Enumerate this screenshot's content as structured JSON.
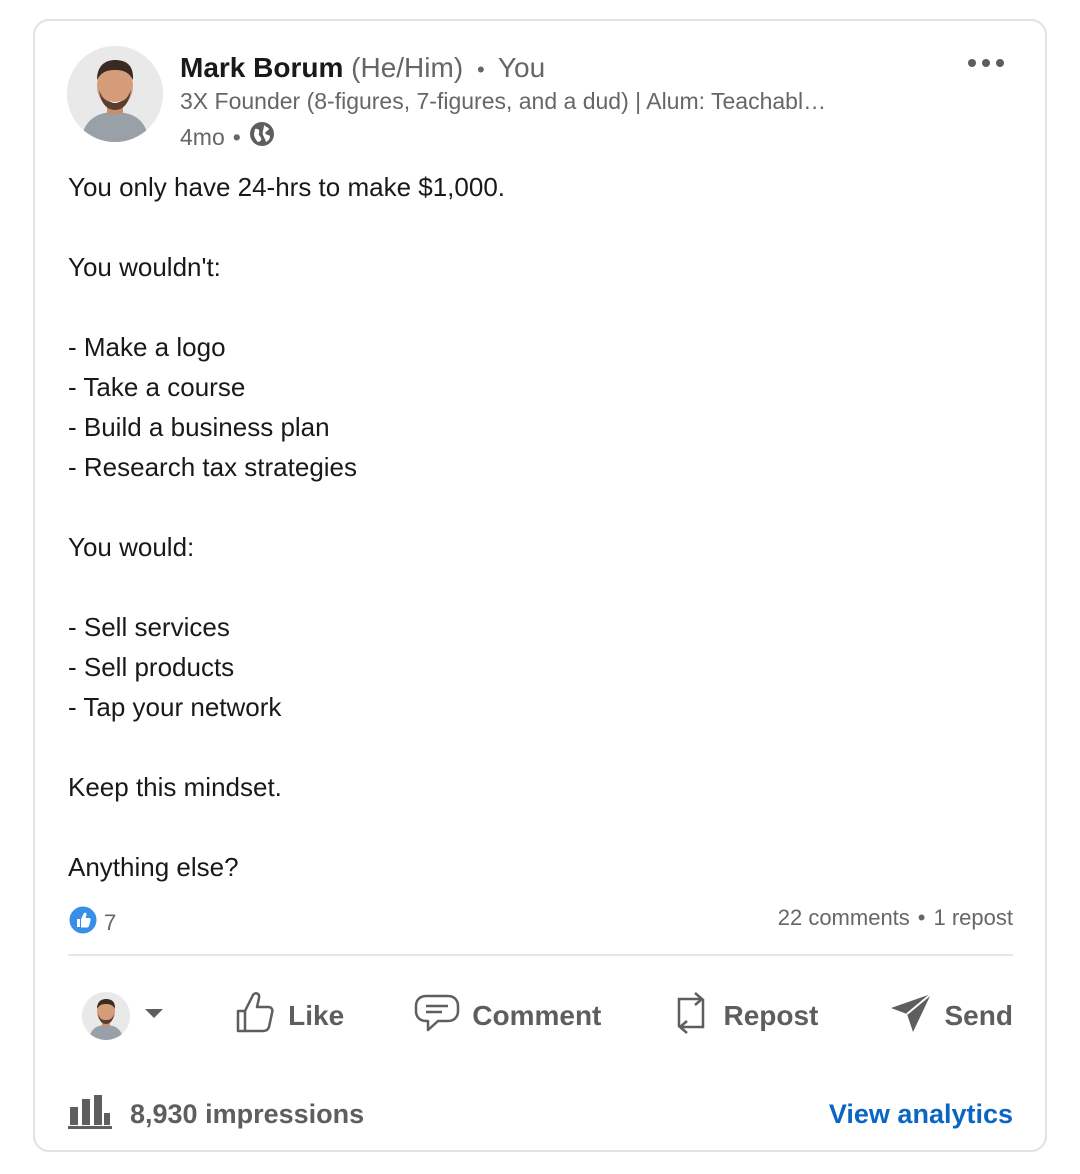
{
  "post": {
    "author": {
      "name": "Mark Borum",
      "pronouns": "(He/Him)",
      "relation": "You",
      "headline": "3X Founder (8-figures, 7-figures, and a dud) | Alum: Teachabl…",
      "time": "4mo",
      "visibility_icon": "globe-icon"
    },
    "body": {
      "line1": "You only have 24-hrs to make $1,000.",
      "line2": "You wouldn't:",
      "wouldnt": [
        "- Make a logo",
        "- Take a course",
        "- Build a business plan",
        "- Research tax strategies"
      ],
      "line3": "You would:",
      "would": [
        "- Sell services",
        "- Sell products",
        "- Tap your network"
      ],
      "line4": "Keep this mindset.",
      "line5": "Anything else?"
    },
    "reactions": {
      "icon": "like-reaction-icon",
      "count": "7"
    },
    "counts": {
      "comments": "22 comments",
      "reposts": "1 repost"
    }
  },
  "actions": {
    "like": "Like",
    "comment": "Comment",
    "repost": "Repost",
    "send": "Send"
  },
  "footer": {
    "impressions": "8,930 impressions",
    "analytics": "View analytics"
  },
  "colors": {
    "link": "#0a66c2",
    "muted": "#666666",
    "action": "#5e5e5e",
    "reaction": "#378fe9"
  }
}
